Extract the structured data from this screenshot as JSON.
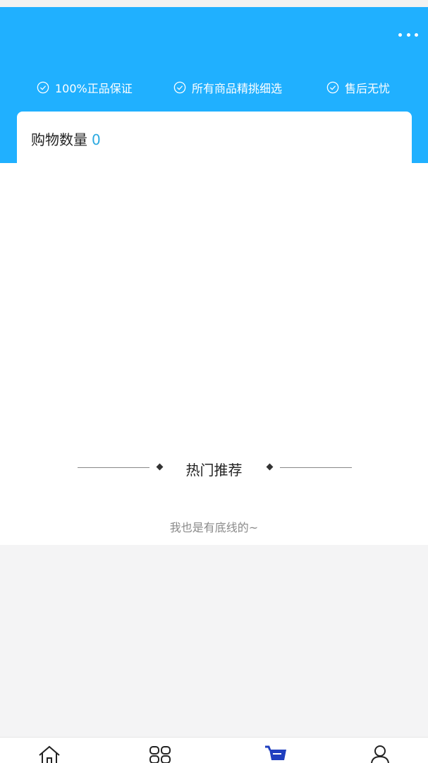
{
  "header": {
    "more_icon": "more-horizontal-icon",
    "guarantees": [
      {
        "label": "100%正品保证",
        "icon": "check-circle-icon"
      },
      {
        "label": "所有商品精挑细选",
        "icon": "check-circle-icon"
      },
      {
        "label": "售后无忧",
        "icon": "check-circle-icon"
      }
    ]
  },
  "cart": {
    "quantity_label": "购物数量",
    "quantity_value": "0"
  },
  "recommend": {
    "title": "热门推荐"
  },
  "footer_note": "我也是有底线的~",
  "tabbar": {
    "tabs": [
      {
        "icon": "home-icon"
      },
      {
        "icon": "category-grid-icon"
      },
      {
        "icon": "cart-icon",
        "active": true
      },
      {
        "icon": "user-icon"
      }
    ]
  },
  "colors": {
    "header": "#20b0ff",
    "accent": "#2aa9e0",
    "active_tab": "#1f3fbf"
  }
}
